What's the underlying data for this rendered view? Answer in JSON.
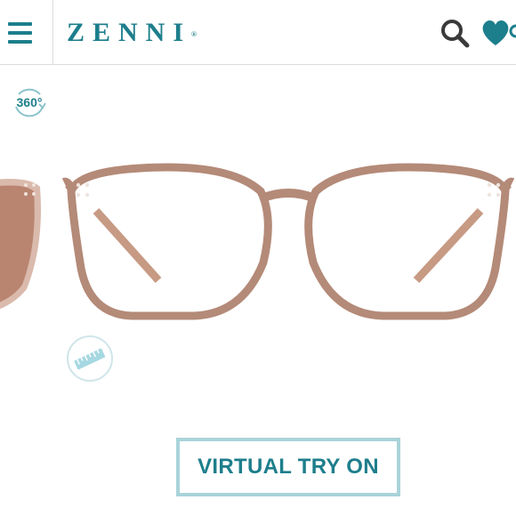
{
  "header": {
    "menu_icon": "hamburger-menu-icon",
    "logo": "ZENNI",
    "logo_mark": "®",
    "search_icon": "search-icon",
    "favorites_icon": "heart-icon"
  },
  "gallery": {
    "badge_360": "360°",
    "measure_icon": "ruler-icon",
    "frame_color": "#b48a78"
  },
  "cta": {
    "virtual_try_on": "VIRTUAL TRY ON"
  },
  "colors": {
    "brand": "#1d7e8c",
    "button_border": "#a9d3da"
  }
}
